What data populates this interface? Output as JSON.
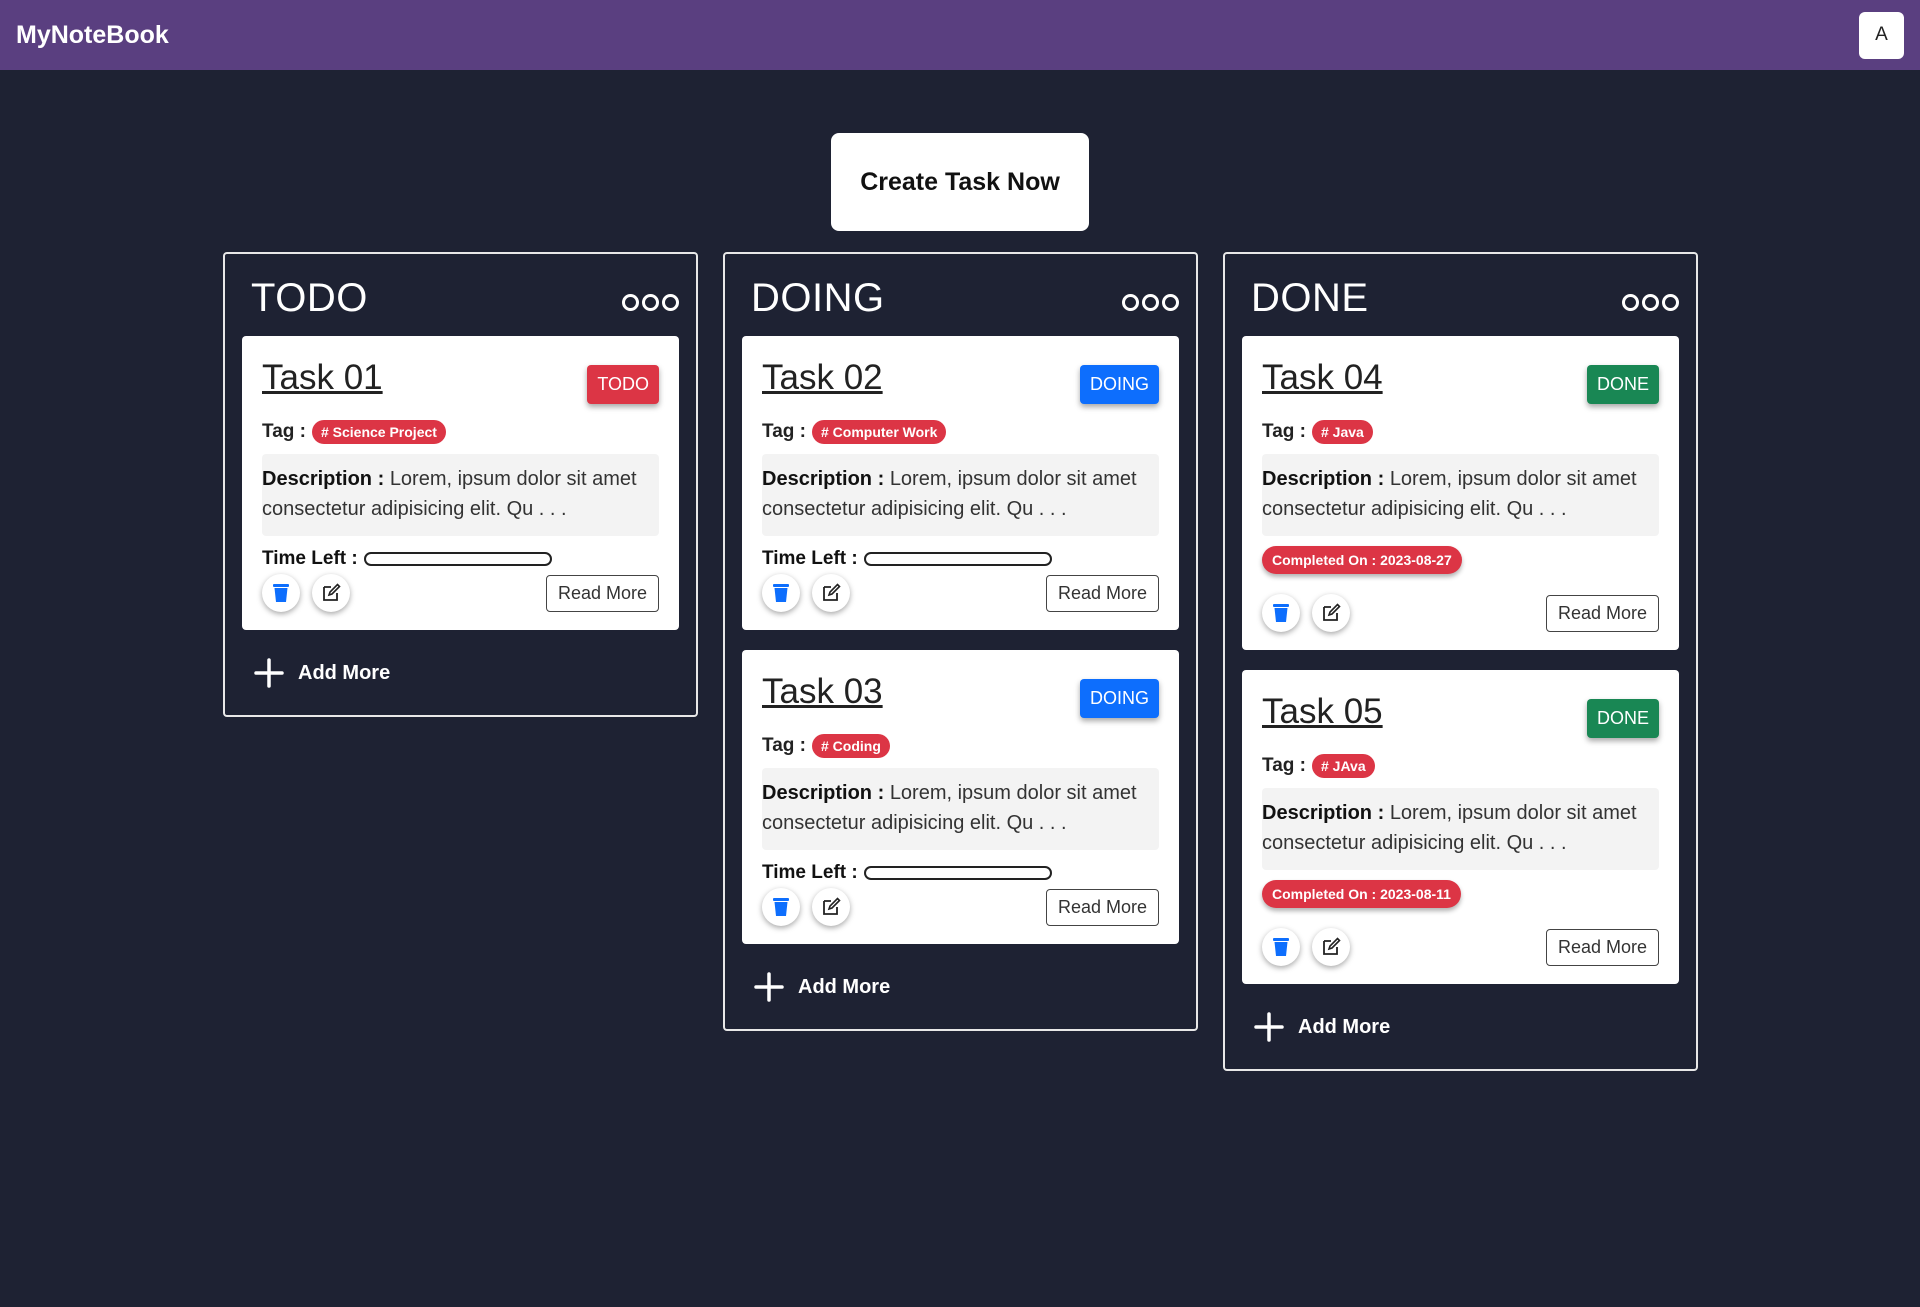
{
  "navbar": {
    "brand": "MyNoteBook",
    "avatar_letter": "A"
  },
  "create_button_label": "Create Task Now",
  "labels": {
    "tag": "Tag :",
    "description": "Description :",
    "time_left": "Time Left :",
    "read_more": "Read More",
    "add_more": "Add More"
  },
  "columns": [
    {
      "title": "TODO",
      "cards": [
        {
          "title": "Task 01",
          "status": "TODO",
          "status_color": "#dc3545",
          "tag": "# Science Project",
          "description": "Lorem, ipsum dolor sit amet consectetur adipisicing elit. Qu . . .",
          "time_left_fraction": 0
        }
      ]
    },
    {
      "title": "DOING",
      "cards": [
        {
          "title": "Task 02",
          "status": "DOING",
          "status_color": "#0d6efd",
          "tag": "# Computer Work",
          "description": "Lorem, ipsum dolor sit amet consectetur adipisicing elit. Qu . . .",
          "time_left_fraction": 0
        },
        {
          "title": "Task 03",
          "status": "DOING",
          "status_color": "#0d6efd",
          "tag": "# Coding",
          "description": "Lorem, ipsum dolor sit amet consectetur adipisicing elit. Qu . . .",
          "time_left_fraction": 0
        }
      ]
    },
    {
      "title": "DONE",
      "cards": [
        {
          "title": "Task 04",
          "status": "DONE",
          "status_color": "#198754",
          "tag": "# Java",
          "description": "Lorem, ipsum dolor sit amet consectetur adipisicing elit. Qu . . .",
          "completed": "Completed On : 2023-08-27"
        },
        {
          "title": "Task 05",
          "status": "DONE",
          "status_color": "#198754",
          "tag": "# JAva",
          "description": "Lorem, ipsum dolor sit amet consectetur adipisicing elit. Qu . . .",
          "completed": "Completed On : 2023-08-11"
        }
      ]
    }
  ],
  "colors": {
    "navbar": "#5a3f80",
    "background": "#1e2233",
    "todo": "#dc3545",
    "doing": "#0d6efd",
    "done": "#198754",
    "tag": "#dc3545"
  },
  "icons": {
    "delete": "trash-icon",
    "edit": "edit-icon",
    "add": "plus-icon",
    "menu": "three-dots-icon"
  }
}
